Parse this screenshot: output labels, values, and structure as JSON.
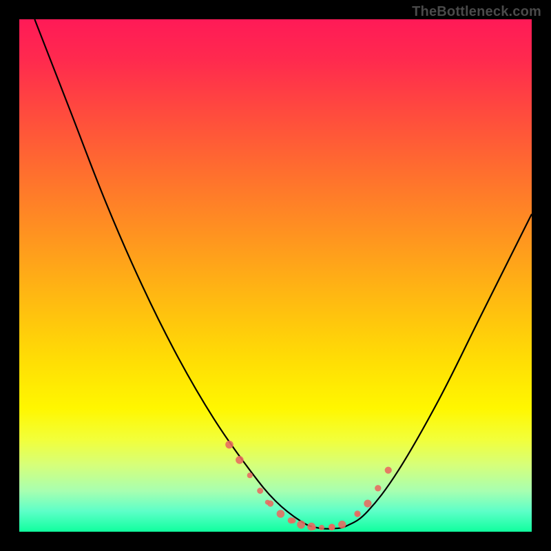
{
  "watermark": {
    "text": "TheBottleneck.com"
  },
  "colors": {
    "frame": "#000000",
    "curve": "#000000",
    "marker": "#e86a60",
    "gradient_stops": [
      "#ff1a57",
      "#ff2a4e",
      "#ff4a3e",
      "#ff6f2e",
      "#ff9320",
      "#ffb812",
      "#ffdc05",
      "#fff700",
      "#f2ff3a",
      "#d6ff7a",
      "#a8ffb0",
      "#5dffc8",
      "#10ff9e"
    ]
  },
  "chart_data": {
    "type": "line",
    "title": "",
    "xlabel": "",
    "ylabel": "",
    "xlim": [
      0,
      100
    ],
    "ylim": [
      0,
      100
    ],
    "note": "V-shaped bottleneck curve. y≈100 is top (worst), y≈0 is bottom (best). Minimum around x≈55–63.",
    "series": [
      {
        "name": "bottleneck-curve",
        "x": [
          3,
          10,
          17,
          24,
          31,
          38,
          45,
          50,
          55,
          58,
          61,
          64,
          68,
          74,
          82,
          90,
          100
        ],
        "y": [
          100,
          82,
          64,
          48,
          34,
          22,
          12,
          6,
          2,
          0.8,
          0.6,
          1.2,
          4,
          12,
          26,
          42,
          62
        ]
      }
    ],
    "markers": {
      "name": "highlighted-points",
      "note": "salmon dots clustered near the valley and on the ascending right limb",
      "x": [
        41,
        43,
        45,
        47,
        49,
        51,
        53,
        55,
        57,
        59,
        61,
        63,
        66,
        68,
        70,
        72
      ],
      "y": [
        17,
        14,
        11,
        8,
        5.5,
        3.5,
        2.2,
        1.4,
        1.0,
        0.8,
        0.9,
        1.4,
        3.5,
        5.5,
        8.5,
        12
      ]
    }
  }
}
